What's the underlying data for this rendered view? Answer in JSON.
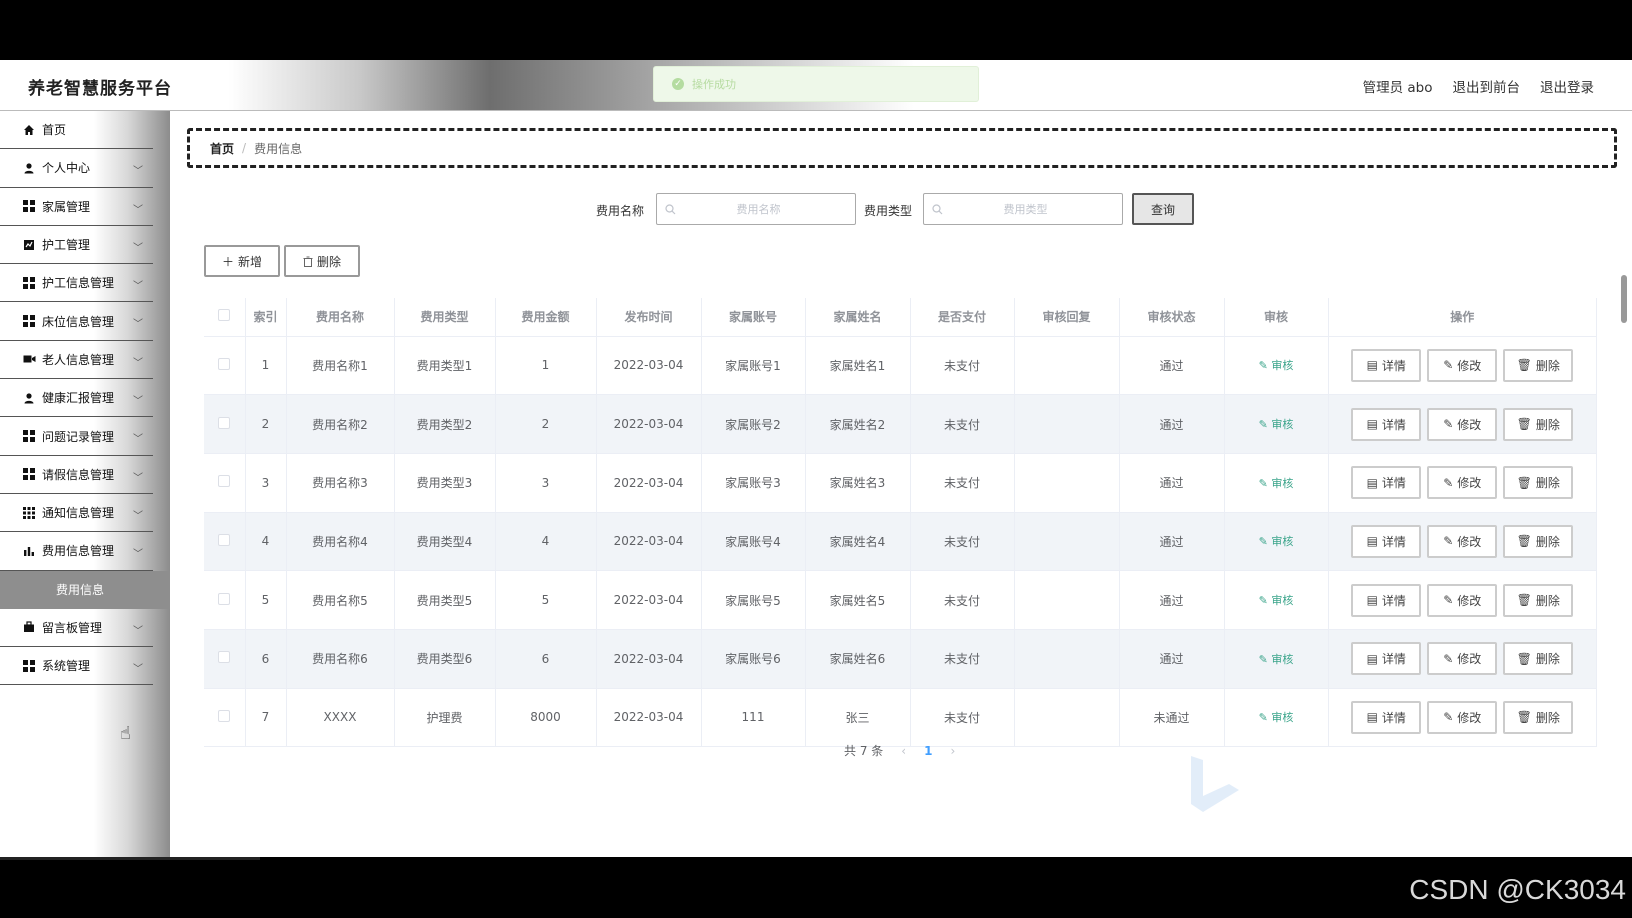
{
  "header": {
    "brand": "养老智慧服务平台",
    "toast": "操作成功",
    "user": "管理员 abo",
    "to_front": "退出到前台",
    "logout": "退出登录"
  },
  "sidebar": {
    "items": [
      {
        "label": "首页",
        "icon": "home-icon"
      },
      {
        "label": "个人中心",
        "icon": "user-icon"
      },
      {
        "label": "家属管理",
        "icon": "grid-icon"
      },
      {
        "label": "护工管理",
        "icon": "chart-box-icon"
      },
      {
        "label": "护工信息管理",
        "icon": "grid-icon"
      },
      {
        "label": "床位信息管理",
        "icon": "grid-icon"
      },
      {
        "label": "老人信息管理",
        "icon": "video-icon"
      },
      {
        "label": "健康汇报管理",
        "icon": "user-icon"
      },
      {
        "label": "问题记录管理",
        "icon": "grid-icon"
      },
      {
        "label": "请假信息管理",
        "icon": "grid-icon"
      },
      {
        "label": "通知信息管理",
        "icon": "grid9-icon"
      },
      {
        "label": "费用信息管理",
        "icon": "bar-chart-icon"
      }
    ],
    "sub_active": "费用信息",
    "items_after": [
      {
        "label": "留言板管理",
        "icon": "briefcase-icon"
      },
      {
        "label": "系统管理",
        "icon": "grid-icon"
      }
    ]
  },
  "breadcrumb": {
    "home": "首页",
    "sep": "/",
    "current": "费用信息"
  },
  "search": {
    "name_label": "费用名称",
    "name_placeholder": "费用名称",
    "type_label": "费用类型",
    "type_placeholder": "费用类型",
    "query_button": "查询"
  },
  "actions": {
    "add": "新增",
    "delete": "删除"
  },
  "table": {
    "headers": [
      "索引",
      "费用名称",
      "费用类型",
      "费用金额",
      "发布时间",
      "家属账号",
      "家属姓名",
      "是否支付",
      "审核回复",
      "审核状态",
      "审核",
      "操作"
    ],
    "rows": [
      {
        "idx": "1",
        "name": "费用名称1",
        "type": "费用类型1",
        "amount": "1",
        "time": "2022-03-04",
        "account": "家属账号1",
        "fname": "家属姓名1",
        "paid": "未支付",
        "reply": "",
        "status": "通过"
      },
      {
        "idx": "2",
        "name": "费用名称2",
        "type": "费用类型2",
        "amount": "2",
        "time": "2022-03-04",
        "account": "家属账号2",
        "fname": "家属姓名2",
        "paid": "未支付",
        "reply": "",
        "status": "通过"
      },
      {
        "idx": "3",
        "name": "费用名称3",
        "type": "费用类型3",
        "amount": "3",
        "time": "2022-03-04",
        "account": "家属账号3",
        "fname": "家属姓名3",
        "paid": "未支付",
        "reply": "",
        "status": "通过"
      },
      {
        "idx": "4",
        "name": "费用名称4",
        "type": "费用类型4",
        "amount": "4",
        "time": "2022-03-04",
        "account": "家属账号4",
        "fname": "家属姓名4",
        "paid": "未支付",
        "reply": "",
        "status": "通过"
      },
      {
        "idx": "5",
        "name": "费用名称5",
        "type": "费用类型5",
        "amount": "5",
        "time": "2022-03-04",
        "account": "家属账号5",
        "fname": "家属姓名5",
        "paid": "未支付",
        "reply": "",
        "status": "通过"
      },
      {
        "idx": "6",
        "name": "费用名称6",
        "type": "费用类型6",
        "amount": "6",
        "time": "2022-03-04",
        "account": "家属账号6",
        "fname": "家属姓名6",
        "paid": "未支付",
        "reply": "",
        "status": "通过"
      },
      {
        "idx": "7",
        "name": "XXXX",
        "type": "护理费",
        "amount": "8000",
        "time": "2022-03-04",
        "account": "111",
        "fname": "张三",
        "paid": "未支付",
        "reply": "",
        "status": "未通过"
      }
    ],
    "audit_label": "审核",
    "op_detail": "详情",
    "op_edit": "修改",
    "op_delete": "删除"
  },
  "pager": {
    "total": "共 7 条",
    "prev": "‹",
    "page": "1",
    "next": "›"
  },
  "watermark": "CSDN @CK3034",
  "colors": {
    "accent": "#409eff",
    "audit": "#3aa48a",
    "toast_bg": "#eef8e9"
  }
}
